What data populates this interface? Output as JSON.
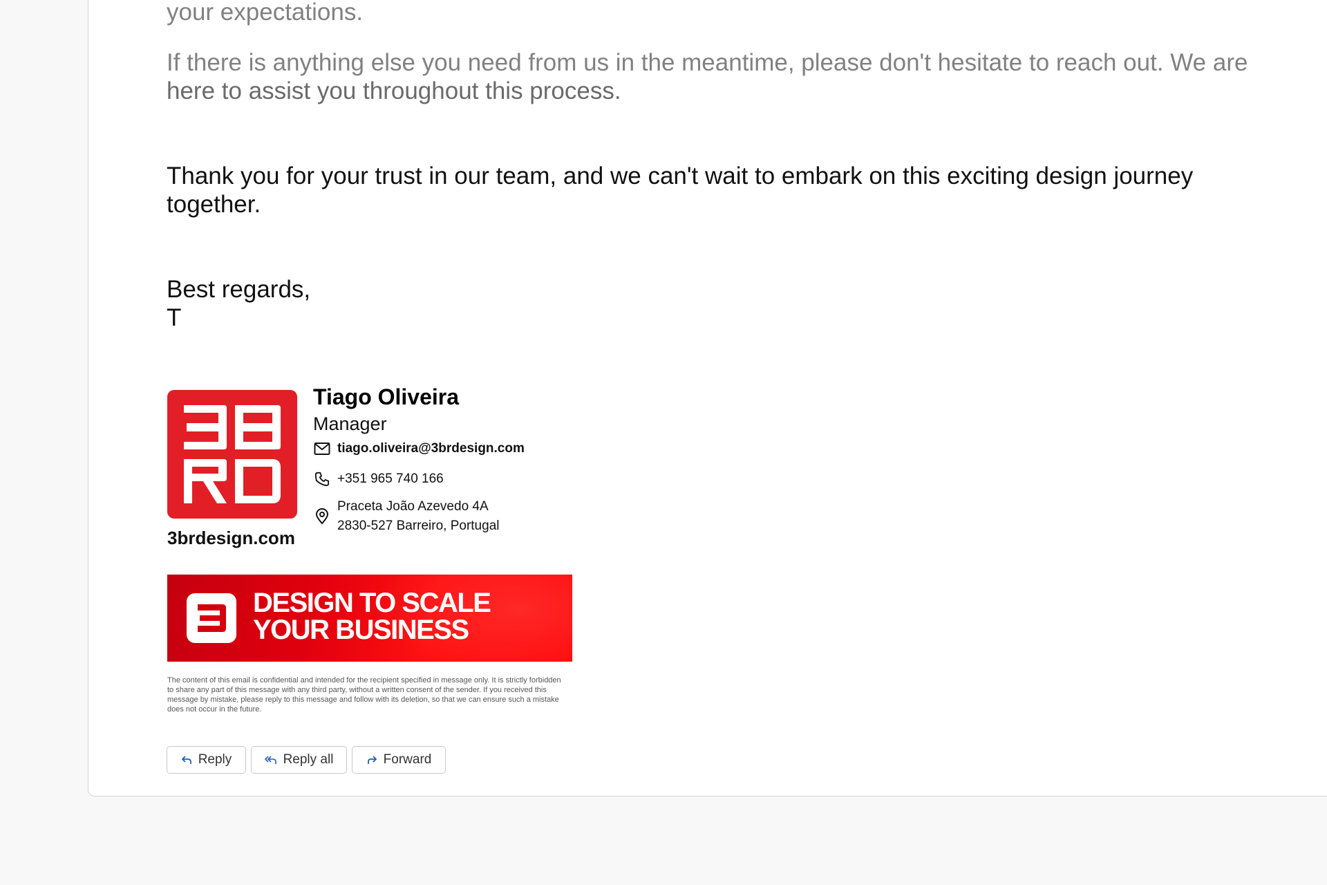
{
  "email": {
    "paragraph_top_fragment": "your expectations.",
    "paragraph_assist_line1": "If there is anything else you need from us in the meantime, please don't hesitate to reach out. We are",
    "paragraph_assist_line2": "here to assist you throughout this process.",
    "paragraph_thanks_line1": "Thank you for your trust in our team, and we can't wait to embark on this exciting design journey",
    "paragraph_thanks_line2": "together.",
    "closing": "Best regards,",
    "initial": "T"
  },
  "signature": {
    "logo_icon": "3brd-logo-icon",
    "website": "3brdesign.com",
    "name": "Tiago Oliveira",
    "role": "Manager",
    "email": "tiago.oliveira@3brdesign.com",
    "phone": "+351 965 740 166",
    "address_line1": "Praceta João Azevedo 4A",
    "address_line2": "2830-527 Barreiro, Portugal",
    "icons": {
      "email": "mail-icon",
      "phone": "phone-icon",
      "address": "location-pin-icon"
    },
    "banner": {
      "line1": "DESIGN TO SCALE",
      "line2": "YOUR BUSINESS",
      "icon": "3brd-mark-icon",
      "color": "#e30613"
    },
    "disclaimer": "The content of this email is confidential and intended for the recipient specified in message only. It is strictly forbidden to share any part of this message with any third party, without a written consent of the sender. If you received this message by mistake, please reply to this message and follow with its deletion, so that we can ensure such a mistake does not occur in the future."
  },
  "actions": {
    "reply": "Reply",
    "reply_all": "Reply all",
    "forward": "Forward",
    "icons": {
      "reply": "reply-icon",
      "reply_all": "reply-all-icon",
      "forward": "forward-icon"
    }
  },
  "colors": {
    "brand_red": "#e21f26",
    "action_blue": "#1f5fbf"
  }
}
